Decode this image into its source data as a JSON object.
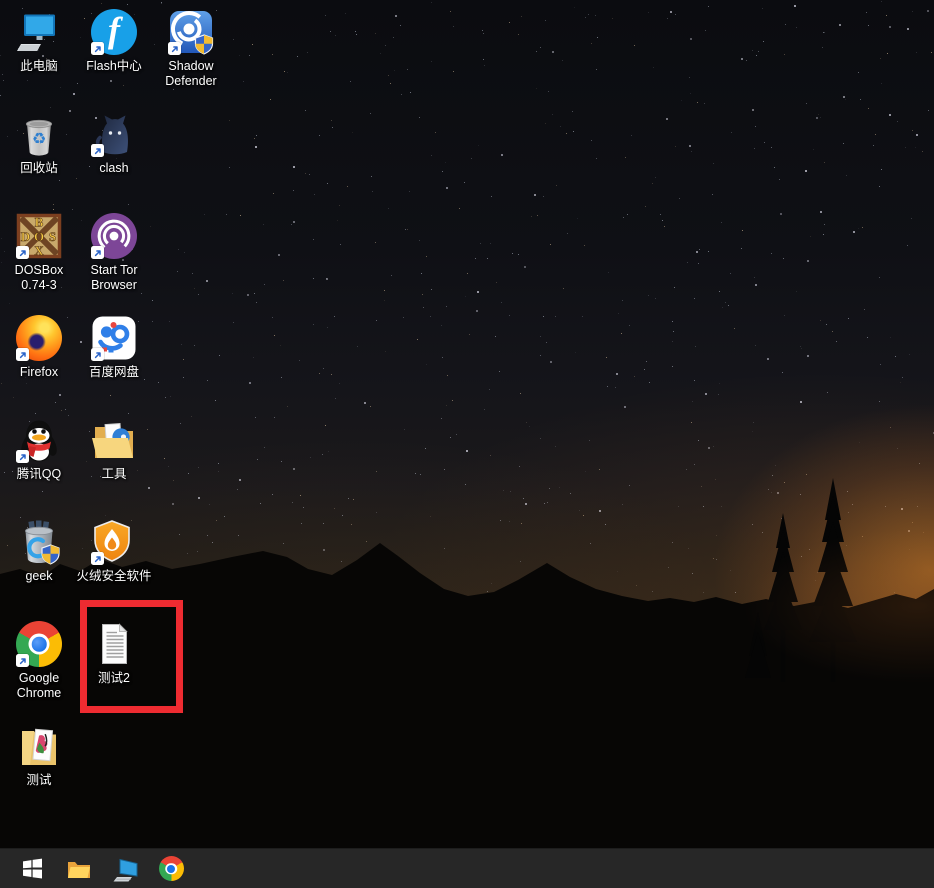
{
  "desktop": {
    "icons": [
      {
        "id": "this-pc",
        "icon": "this-pc-icon",
        "label": "此电脑",
        "col": 0,
        "row": 0,
        "shortcut": false
      },
      {
        "id": "flash-center",
        "icon": "flash-center-icon",
        "label": "Flash中心",
        "col": 1,
        "row": 0,
        "shortcut": true
      },
      {
        "id": "shadow-defender",
        "icon": "shadow-defender-icon",
        "label": "Shadow Defender",
        "col": 2,
        "row": 0,
        "shortcut": true
      },
      {
        "id": "recycle-bin",
        "icon": "recycle-bin-icon",
        "label": "回收站",
        "col": 0,
        "row": 1,
        "shortcut": false
      },
      {
        "id": "clash",
        "icon": "clash-cat-icon",
        "label": "clash",
        "col": 1,
        "row": 1,
        "shortcut": true
      },
      {
        "id": "dosbox",
        "icon": "dosbox-icon",
        "label": "DOSBox 0.74-3",
        "col": 0,
        "row": 2,
        "shortcut": true
      },
      {
        "id": "tor-browser",
        "icon": "tor-onion-icon",
        "label": "Start Tor Browser",
        "col": 1,
        "row": 2,
        "shortcut": true
      },
      {
        "id": "firefox",
        "icon": "firefox-icon",
        "label": "Firefox",
        "col": 0,
        "row": 3,
        "shortcut": true
      },
      {
        "id": "baidu-netdisk",
        "icon": "baidu-netdisk-icon",
        "label": "百度网盘",
        "col": 1,
        "row": 3,
        "shortcut": true
      },
      {
        "id": "tencent-qq",
        "icon": "qq-penguin-icon",
        "label": "腾讯QQ",
        "col": 0,
        "row": 4,
        "shortcut": true
      },
      {
        "id": "tools-folder",
        "icon": "folder-tools-icon",
        "label": "工具",
        "col": 1,
        "row": 4,
        "shortcut": false
      },
      {
        "id": "geek",
        "icon": "geek-uninstaller-icon",
        "label": "geek",
        "col": 0,
        "row": 5,
        "shortcut": false
      },
      {
        "id": "huorong",
        "icon": "huorong-shield-icon",
        "label": "火绒安全软件",
        "col": 1,
        "row": 5,
        "shortcut": true,
        "wide": true
      },
      {
        "id": "google-chrome",
        "icon": "chrome-icon",
        "label": "Google Chrome",
        "col": 0,
        "row": 6,
        "shortcut": true
      },
      {
        "id": "test2-doc",
        "icon": "text-document-icon",
        "label": "测试2",
        "col": 1,
        "row": 6,
        "shortcut": false,
        "highlighted": true
      },
      {
        "id": "test-folder",
        "icon": "folder-test-icon",
        "label": "测试",
        "col": 0,
        "row": 7,
        "shortcut": false
      }
    ],
    "highlight": {
      "target_label": "测试2",
      "color": "#ee2b31"
    }
  },
  "taskbar": {
    "background": "#272727",
    "items": [
      {
        "id": "start",
        "icon": "windows-start-icon"
      },
      {
        "id": "explorer",
        "icon": "file-explorer-icon"
      },
      {
        "id": "pc",
        "icon": "pc-monitor-icon"
      },
      {
        "id": "chrome",
        "icon": "chrome-icon"
      }
    ]
  },
  "wallpaper": {
    "description_colors": {
      "sky_top": "#0b0c10",
      "horizon_glow": "#ee8e2c",
      "mountains": "#070605"
    }
  }
}
